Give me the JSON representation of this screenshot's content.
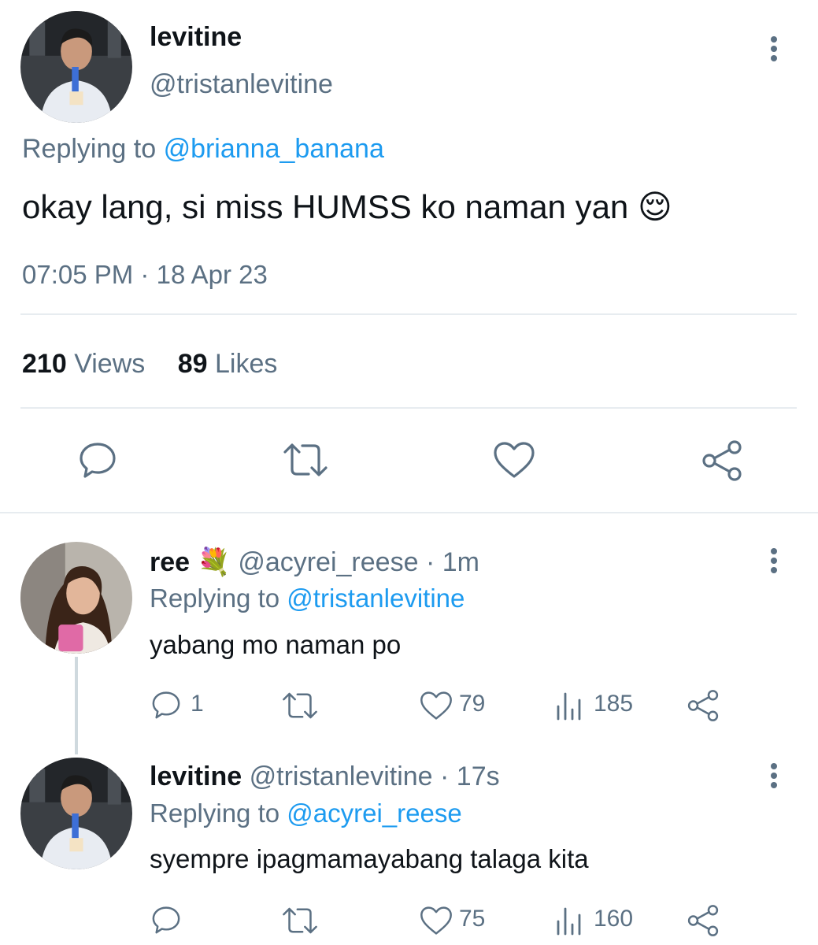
{
  "main_tweet": {
    "author_name": "levitine",
    "author_handle": "@tristanlevitine",
    "replying_label": "Replying to",
    "replying_handle": "@brianna_banana",
    "text": "okay lang, si miss HUMSS ko naman yan",
    "emoji": "😌",
    "time": "07:05 PM",
    "dot": "·",
    "date": "18 Apr 23",
    "views_count": "210",
    "views_label": "Views",
    "likes_count": "89",
    "likes_label": "Likes"
  },
  "replies": [
    {
      "author_name": "ree",
      "author_emoji": "💐",
      "author_handle": "@acyrei_reese",
      "dot": "·",
      "age": "1m",
      "replying_label": "Replying to",
      "replying_handle": "@tristanlevitine",
      "text": "yabang mo naman po",
      "reply_count": "1",
      "like_count": "79",
      "view_count": "185"
    },
    {
      "author_name": "levitine",
      "author_handle": "@tristanlevitine",
      "dot": "·",
      "age": "17s",
      "replying_label": "Replying to",
      "replying_handle": "@acyrei_reese",
      "text": "syempre ipagmamayabang talaga kita",
      "reply_count": "",
      "like_count": "75",
      "view_count": "160"
    }
  ],
  "colors": {
    "link": "#1d9bf0",
    "muted": "#5b7083",
    "text": "#0f1419",
    "divider": "#e7ecf0"
  },
  "icons": [
    "more-icon",
    "reply-icon",
    "retweet-icon",
    "like-icon",
    "share-icon",
    "views-icon"
  ]
}
